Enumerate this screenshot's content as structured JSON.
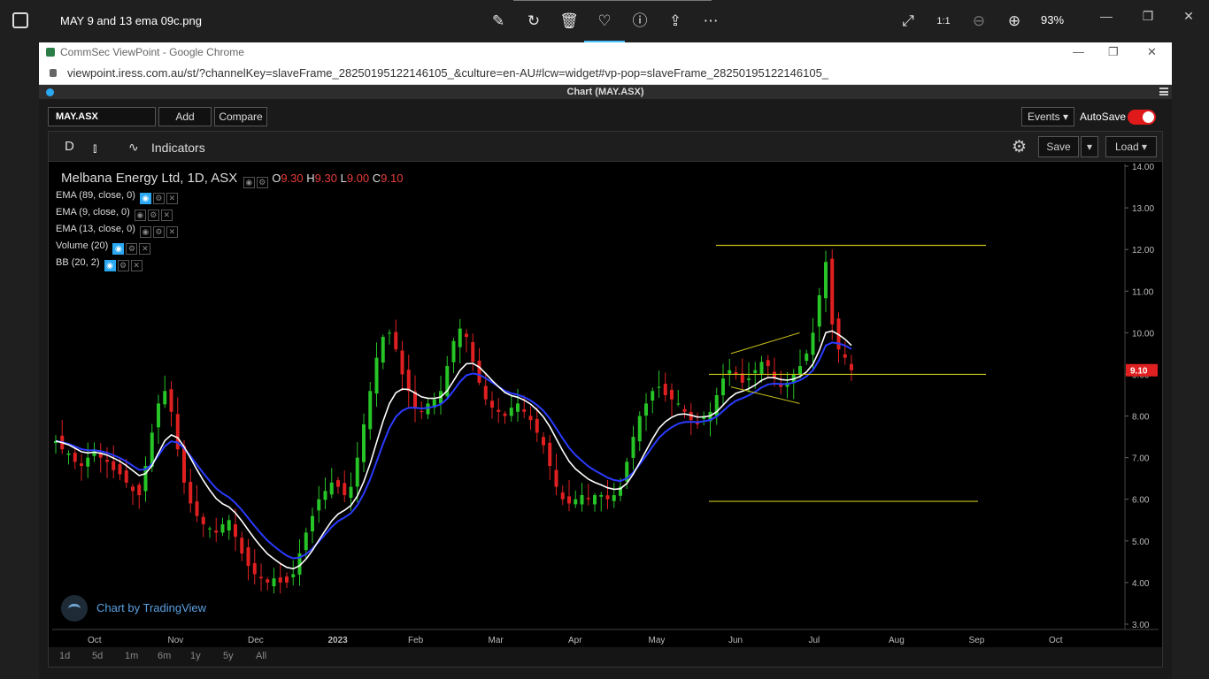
{
  "viewer": {
    "file_title": "MAY 9 and 13 ema 09c.png",
    "zoom": "93%",
    "tools": [
      "edit-icon",
      "rotate-icon",
      "delete-icon",
      "heart-icon",
      "info-icon",
      "share-icon",
      "more-icon"
    ]
  },
  "browser": {
    "window_title": "CommSec ViewPoint - Google Chrome",
    "url": "viewpoint.iress.com.au/st/?channelKey=slaveFrame_28250195122146105_&culture=en-AU#lcw=widget#vp-pop=slaveFrame_28250195122146105_"
  },
  "app": {
    "header_title": "Chart (MAY.ASX)",
    "symbol": "MAY.ASX",
    "add_label": "Add",
    "compare_label": "Compare",
    "events_label": "Events",
    "autosave_label": "AutoSave",
    "autosave_on": true
  },
  "toolbar": {
    "timeframe": "D",
    "indicators_label": "Indicators",
    "save_label": "Save",
    "load_label": "Load"
  },
  "legend": {
    "title": "Melbana Energy Ltd, 1D, ASX",
    "o_label": "O",
    "o_value": "9.30",
    "h_label": "H",
    "h_value": "9.30",
    "l_label": "L",
    "l_value": "9.00",
    "c_label": "C",
    "c_value": "9.10",
    "indicators": [
      "EMA (89, close, 0)",
      "EMA (9, close, 0)",
      "EMA (13, close, 0)",
      "Volume (20)",
      "BB (20, 2)"
    ]
  },
  "branding": "Chart by TradingView",
  "periods": [
    "1d",
    "5d",
    "1m",
    "6m",
    "1y",
    "5y",
    "All"
  ],
  "colors": {
    "up": "#26c426",
    "down": "#e02020",
    "ema9": "#ffffff",
    "ema13": "#2a3bff",
    "trend": "#c8c21a",
    "price_tag": "#e02020"
  },
  "chart_data": {
    "type": "candlestick",
    "y_ticks": [
      "14.00",
      "13.00",
      "12.00",
      "11.00",
      "10.00",
      "9.00",
      "8.00",
      "7.00",
      "6.00",
      "5.00",
      "4.00",
      "3.00"
    ],
    "ylim": [
      3,
      14
    ],
    "x_labels": [
      "Oct",
      "Nov",
      "Dec",
      "2023",
      "Feb",
      "Mar",
      "Apr",
      "May",
      "Jun",
      "Jul",
      "Aug",
      "Sep",
      "Oct"
    ],
    "last_price": "9.10",
    "closes": [
      7.4,
      7.2,
      7.1,
      6.9,
      6.8,
      7.0,
      7.2,
      7.0,
      6.9,
      6.7,
      6.6,
      6.4,
      6.2,
      6.1,
      6.8,
      7.6,
      8.3,
      8.6,
      8.1,
      7.2,
      6.4,
      5.9,
      5.6,
      5.4,
      5.3,
      5.2,
      5.4,
      5.5,
      5.1,
      4.7,
      4.4,
      4.2,
      4.1,
      4.0,
      4.1,
      4.0,
      4.0,
      4.2,
      4.7,
      5.2,
      5.6,
      6.0,
      6.2,
      6.4,
      6.3,
      6.1,
      6.3,
      7.0,
      7.8,
      8.6,
      9.4,
      9.9,
      10.0,
      9.6,
      9.0,
      8.6,
      8.2,
      8.1,
      8.3,
      8.4,
      8.6,
      9.2,
      9.8,
      10.1,
      9.9,
      9.3,
      8.8,
      8.4,
      8.2,
      8.1,
      8.0,
      8.2,
      8.3,
      8.1,
      7.9,
      7.6,
      7.3,
      6.8,
      6.3,
      6.0,
      5.9,
      6.0,
      6.1,
      6.0,
      6.1,
      6.1,
      6.0,
      6.1,
      6.3,
      6.9,
      7.5,
      8.0,
      8.3,
      8.6,
      8.7,
      8.5,
      8.4,
      8.3,
      8.1,
      7.9,
      7.8,
      8.0,
      8.1,
      8.5,
      8.9,
      9.1,
      9.0,
      8.8,
      8.9,
      9.1,
      9.3,
      9.2,
      8.9,
      8.7,
      8.8,
      9.0,
      9.2,
      9.5,
      10.0,
      10.9,
      11.7,
      10.2,
      9.6,
      9.4,
      9.1
    ],
    "horizontal_levels": [
      12.1,
      9.0,
      5.95
    ],
    "channel_upper": [
      [
        9.5,
        100
      ],
      [
        10.0,
        110
      ]
    ],
    "channel_lower": [
      [
        8.7,
        100
      ],
      [
        8.3,
        110
      ]
    ]
  }
}
